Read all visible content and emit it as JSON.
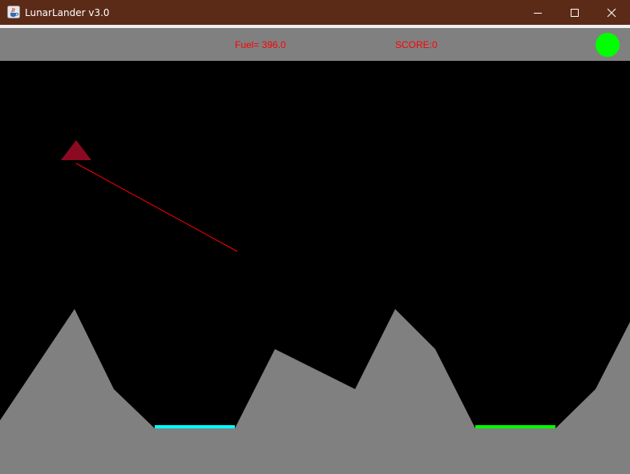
{
  "window": {
    "title": "LunarLander v3.0",
    "icon": "java-coffee-cup-icon",
    "controls": [
      "minimize-icon",
      "maximize-icon",
      "close-icon"
    ]
  },
  "hud": {
    "fuel_text": "Fuel= 396.0",
    "score_text": "SCORE:0",
    "text_color": "#ff0000",
    "background": "#808080",
    "status_light_color": "#00ff00"
  },
  "game": {
    "background": "#000000",
    "terrain_color": "#808080",
    "lander_color": "#8b0a22",
    "thrust_line_color": "#ff0000",
    "landing_pads": [
      {
        "color": "#00ffff"
      },
      {
        "color": "#00ff00"
      }
    ]
  }
}
